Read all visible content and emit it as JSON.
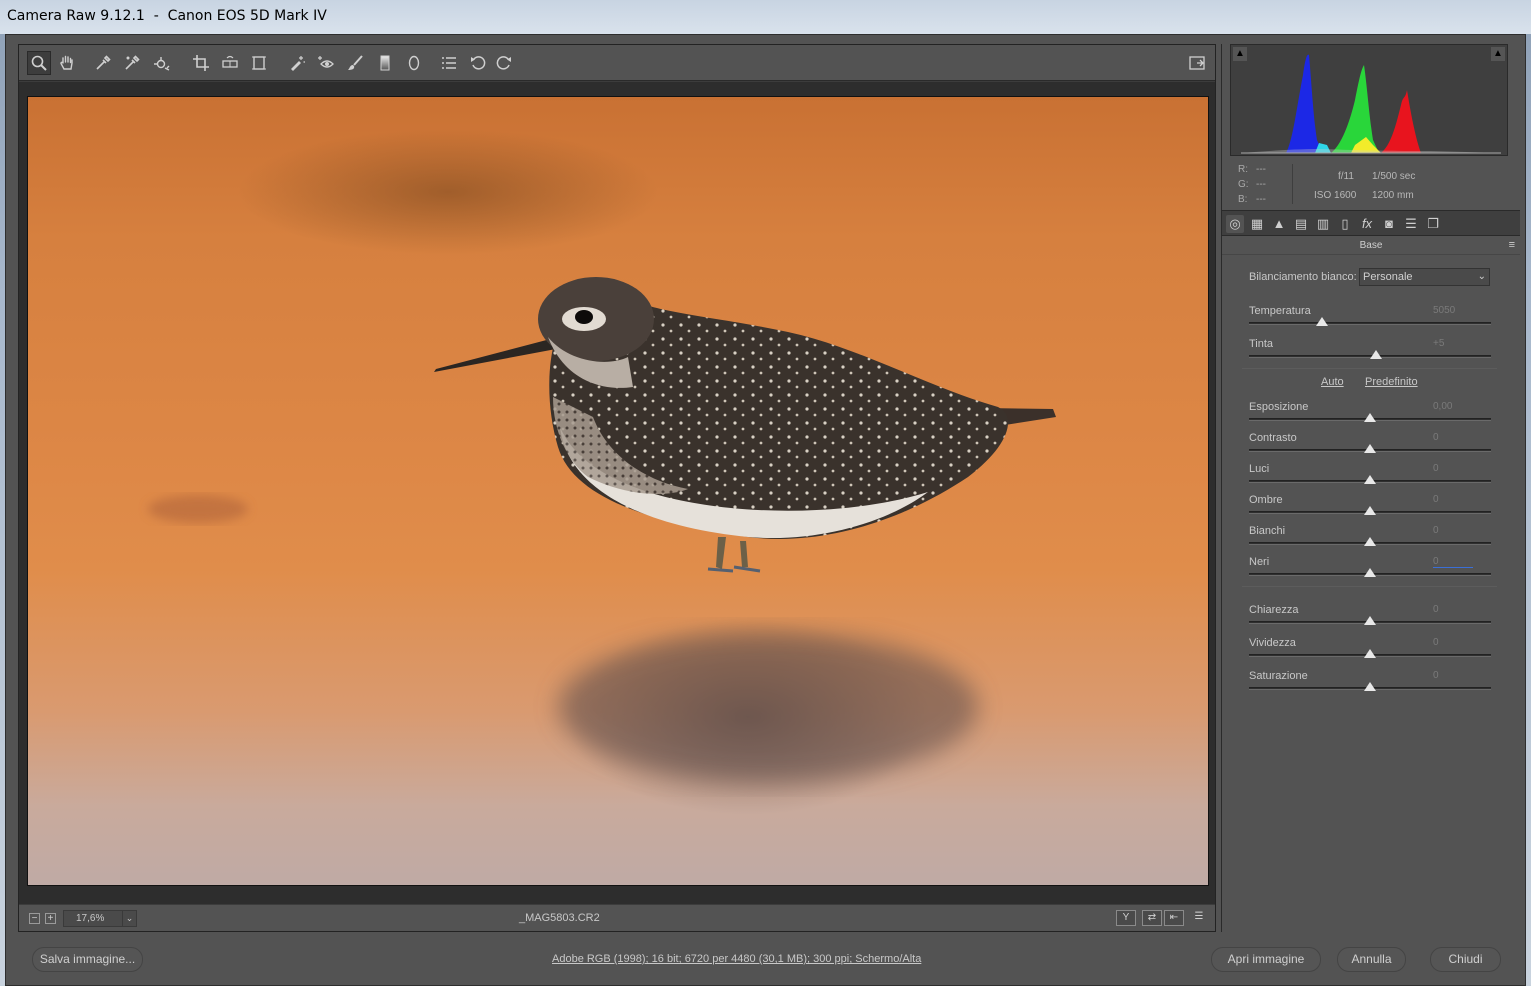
{
  "window": {
    "title": "Camera Raw 9.12.1  -  Canon EOS 5D Mark IV"
  },
  "toolbar": {
    "tools": [
      {
        "name": "zoom-tool",
        "icon": "magnifier-icon",
        "active": true
      },
      {
        "name": "hand-tool",
        "icon": "hand-icon"
      },
      {
        "name": "white-balance-tool",
        "icon": "eyedropper-icon"
      },
      {
        "name": "color-sampler-tool",
        "icon": "color-sampler-icon"
      },
      {
        "name": "targeted-adjustment-tool",
        "icon": "target-icon"
      },
      {
        "name": "crop-tool",
        "icon": "crop-icon"
      },
      {
        "name": "straighten-tool",
        "icon": "level-icon"
      },
      {
        "name": "transform-tool",
        "icon": "transform-icon"
      },
      {
        "name": "spot-removal-tool",
        "icon": "spot-brush-icon"
      },
      {
        "name": "red-eye-tool",
        "icon": "red-eye-icon"
      },
      {
        "name": "adjustment-brush-tool",
        "icon": "brush-icon"
      },
      {
        "name": "graduated-filter-tool",
        "icon": "graduated-icon"
      },
      {
        "name": "radial-filter-tool",
        "icon": "radial-icon"
      },
      {
        "name": "preferences-button",
        "icon": "list-icon"
      },
      {
        "name": "rotate-left-button",
        "icon": "rotate-ccw-icon"
      },
      {
        "name": "rotate-right-button",
        "icon": "rotate-cw-icon"
      }
    ],
    "fullscreen_icon": "fullscreen-icon"
  },
  "statusbar": {
    "zoom_out": "−",
    "zoom_in": "+",
    "zoom_value": "17,6%",
    "zoom_dropdown": "⌄",
    "filename": "_MAG5803.CR2",
    "view_buttons": [
      "Y",
      "⇄",
      "⇤",
      "☰"
    ]
  },
  "info": {
    "r_label": "R:",
    "r_value": "---",
    "g_label": "G:",
    "g_value": "---",
    "b_label": "B:",
    "b_value": "---",
    "aperture": "f/11",
    "shutter": "1/500 sec",
    "iso": "ISO 1600",
    "focal": "1200 mm"
  },
  "panel": {
    "title": "Base",
    "menu_icon": "≡",
    "tabs": [
      "basic-icon",
      "tone-curve-icon",
      "detail-icon",
      "hsl-icon",
      "split-toning-icon",
      "lens-icon",
      "fx-icon",
      "camera-calibration-icon",
      "presets-icon",
      "snapshots-icon"
    ],
    "wb_label": "Bilanciamento bianco:",
    "wb_value": "Personale",
    "auto_label": "Auto",
    "default_label": "Predefinito",
    "sliders": [
      {
        "label": "Temperatura",
        "value": "5050",
        "fraction": 0.3
      },
      {
        "label": "Tinta",
        "value": "+5",
        "fraction": 0.525
      },
      {
        "label": "Esposizione",
        "value": "0,00",
        "fraction": 0.5
      },
      {
        "label": "Contrasto",
        "value": "0",
        "fraction": 0.5
      },
      {
        "label": "Luci",
        "value": "0",
        "fraction": 0.5
      },
      {
        "label": "Ombre",
        "value": "0",
        "fraction": 0.5
      },
      {
        "label": "Bianchi",
        "value": "0",
        "fraction": 0.5
      },
      {
        "label": "Neri",
        "value": "0",
        "fraction": 0.5
      },
      {
        "label": "Chiarezza",
        "value": "0",
        "fraction": 0.5
      },
      {
        "label": "Vividezza",
        "value": "0",
        "fraction": 0.5
      },
      {
        "label": "Saturazione",
        "value": "0",
        "fraction": 0.5
      }
    ]
  },
  "bottom": {
    "save_label": "Salva immagine...",
    "workflow_label": "Adobe RGB (1998); 16 bit; 6720 per 4480 (30,1 MB); 300 ppi; Schermo/Alta",
    "open_label": "Apri immagine",
    "cancel_label": "Annulla",
    "close_label": "Chiudi"
  },
  "colors": {
    "histogram_red": "#e8141e",
    "histogram_green": "#29d63a",
    "histogram_blue": "#1c28e6",
    "accent": "#3b6fd6"
  }
}
